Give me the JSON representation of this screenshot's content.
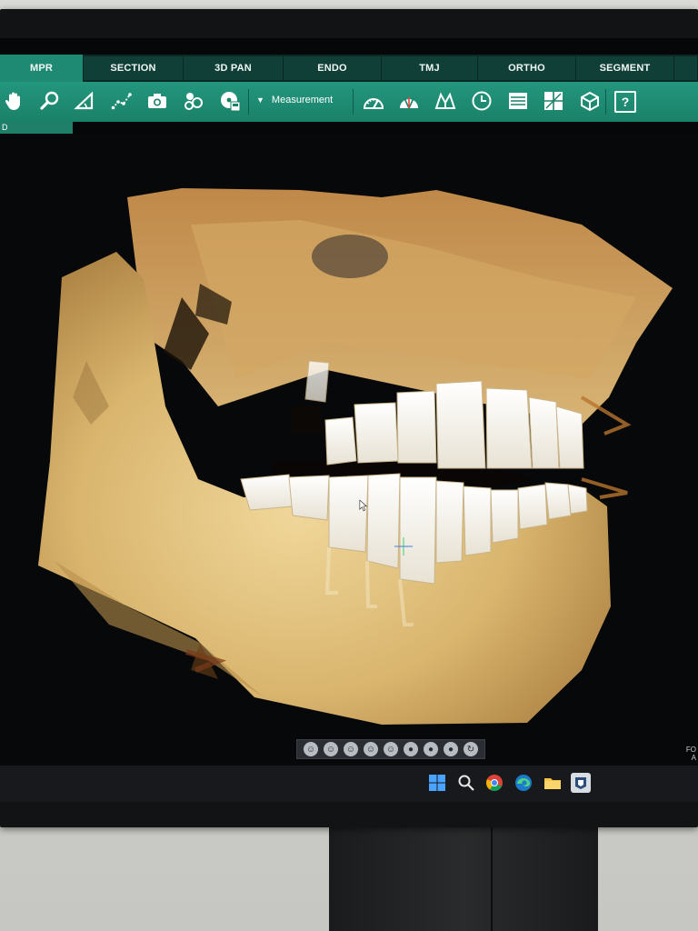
{
  "tabs": [
    {
      "label": "MPR",
      "active": true
    },
    {
      "label": "SECTION"
    },
    {
      "label": "3D PAN"
    },
    {
      "label": "ENDO"
    },
    {
      "label": "TMJ"
    },
    {
      "label": "ORTHO"
    },
    {
      "label": "SEGMENT"
    }
  ],
  "toolbar": {
    "measure_label": "Measurement",
    "icons": [
      "hand-icon",
      "zoom-icon",
      "angle-icon",
      "polyline-icon",
      "camera-icon",
      "people-icon",
      "disk-icon",
      "ruler-meter-icon",
      "protractor-icon",
      "mirror-icon",
      "clock-icon",
      "layers-icon",
      "grid-icon",
      "cube-icon",
      "help-icon"
    ],
    "help_glyph": "?"
  },
  "subtab": {
    "label": "D"
  },
  "viewbar": {
    "icons": [
      "view-front-icon",
      "view-left-icon",
      "view-right-icon",
      "view-back-icon",
      "view-top-icon",
      "view-bottom-icon",
      "view-lateral-icon",
      "view-reset-icon",
      "rotate-icon"
    ]
  },
  "corner_label": "FO\nA",
  "taskbar": {
    "icons": [
      "windows-start-icon",
      "search-icon",
      "chrome-icon",
      "edge-icon",
      "explorer-folder-icon",
      "app-icon"
    ]
  },
  "colors": {
    "accent": "#23977e",
    "tab_active": "#1f8a73",
    "tab": "#0f3f37",
    "bone": "#d8b46e"
  }
}
